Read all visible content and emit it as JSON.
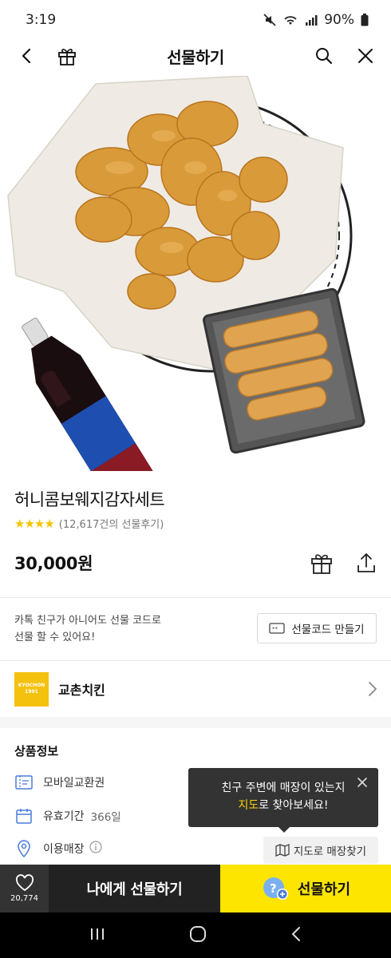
{
  "status": {
    "time": "3:19",
    "battery": "90%"
  },
  "nav": {
    "title": "선물하기"
  },
  "product": {
    "name": "허니콤보웨지감자세트",
    "rating_stars": 4,
    "review_count": "(12,617건의 선물후기)",
    "price": "30,000원"
  },
  "gift_code": {
    "description_line1": "카톡 친구가 아니어도 선물 코드로",
    "description_line2": "선물 할 수 있어요!",
    "button_label": "선물코드 만들기"
  },
  "brand": {
    "name": "교촌치킨",
    "logo_text": "KYOCHON",
    "logo_sub": "1991"
  },
  "info": {
    "title": "상품정보",
    "type_label": "모바일교환권",
    "validity_label": "유효기간",
    "validity_value": "366일",
    "store_label": "이용매장"
  },
  "tooltip": {
    "line1": "친구 주변에 매장이 있는지",
    "line2_highlight": "지도",
    "line2_rest": "로 찾아보세요!"
  },
  "map_button": {
    "label": "지도로 매장찾기"
  },
  "bottom": {
    "wish_count": "20,774",
    "self_gift_label": "나에게 선물하기",
    "gift_label": "선물하기"
  },
  "colors": {
    "accent": "#fee500",
    "dark": "#222222",
    "brand": "#f4c10e",
    "star": "#f5c400"
  }
}
